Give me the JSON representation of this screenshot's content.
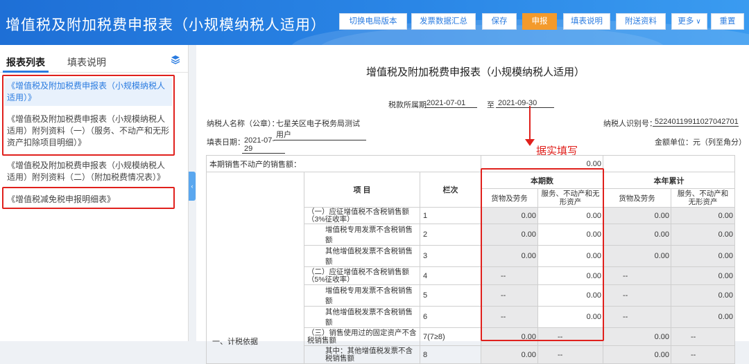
{
  "header": {
    "title": "增值税及附加税费申报表（小规模纳税人适用）",
    "buttons": {
      "switch_version": "切换电局版本",
      "summary": "发票数据汇总",
      "save": "保存",
      "declare": "申报",
      "instructions": "填表说明",
      "attachments": "附送资料",
      "more": "更多",
      "reset": "重置"
    }
  },
  "sidebar": {
    "tabs": [
      "报表列表",
      "填表说明"
    ],
    "items": [
      "《增值税及附加税费申报表（小规模纳税人适用）》",
      "《增值税及附加税费申报表（小规模纳税人适用）附列资料（一）（服务、不动产和无形资产扣除项目明细）》",
      "《增值税及附加税费申报表（小规模纳税人适用）附列资料（二）（附加税费情况表）》",
      "《增值税减免税申报明细表》"
    ]
  },
  "form": {
    "title": "增值税及附加税费申报表（小规模纳税人适用）",
    "period_label": "税款所属期",
    "period_start": "2021-07-01",
    "period_to": "至",
    "period_end": "2021-09-30",
    "taxpayer_label": "纳税人名称（公章）：",
    "taxpayer_name": "七星关区电子税务局测试用户",
    "id_label": "纳税人识别号：",
    "taxpayer_id": "52240119911027042701",
    "fill_date_label": "填表日期：",
    "fill_date": "2021-07-29",
    "unit_label": "金额单位：元（列至角分）",
    "annotation": "据实填写"
  },
  "table": {
    "unsold_label": "本期销售不动产的销售额：",
    "unsold_value": "0.00",
    "col_item": "项  目",
    "col_row": "栏次",
    "col_current": "本期数",
    "col_ytd": "本年累计",
    "col_goods": "货物及劳务",
    "col_services": "服务、不动产和无形资产",
    "group_label": "一、计税依据",
    "rows": [
      {
        "label": "（一）应征增值税不含税销售额（3%征收率）",
        "no": "1",
        "c1": "0.00",
        "c2": "0.00",
        "c3": "0.00",
        "c4": "0.00"
      },
      {
        "label": "增值税专用发票不含税销售额",
        "no": "2",
        "c1": "0.00",
        "c2": "0.00",
        "c3": "0.00",
        "c4": "0.00"
      },
      {
        "label": "其他增值税发票不含税销售额",
        "no": "3",
        "c1": "0.00",
        "c2": "0.00",
        "c3": "0.00",
        "c4": "0.00"
      },
      {
        "label": "（二）应征增值税不含税销售额（5%征收率）",
        "no": "4",
        "c1": "--",
        "c2": "0.00",
        "c3": "--",
        "c4": "0.00"
      },
      {
        "label": "增值税专用发票不含税销售额",
        "no": "5",
        "c1": "--",
        "c2": "0.00",
        "c3": "--",
        "c4": "0.00"
      },
      {
        "label": "其他增值税发票不含税销售额",
        "no": "6",
        "c1": "--",
        "c2": "0.00",
        "c3": "--",
        "c4": "0.00"
      },
      {
        "label": "（三）销售使用过的固定资产不含税销售额",
        "no": "7(7≥8)",
        "c1": "0.00",
        "c2": "--",
        "c3": "0.00",
        "c4": "--"
      },
      {
        "label": "其中：其他增值税发票不含税销售额",
        "no": "8",
        "c1": "0.00",
        "c2": "--",
        "c3": "0.00",
        "c4": "--"
      }
    ]
  }
}
